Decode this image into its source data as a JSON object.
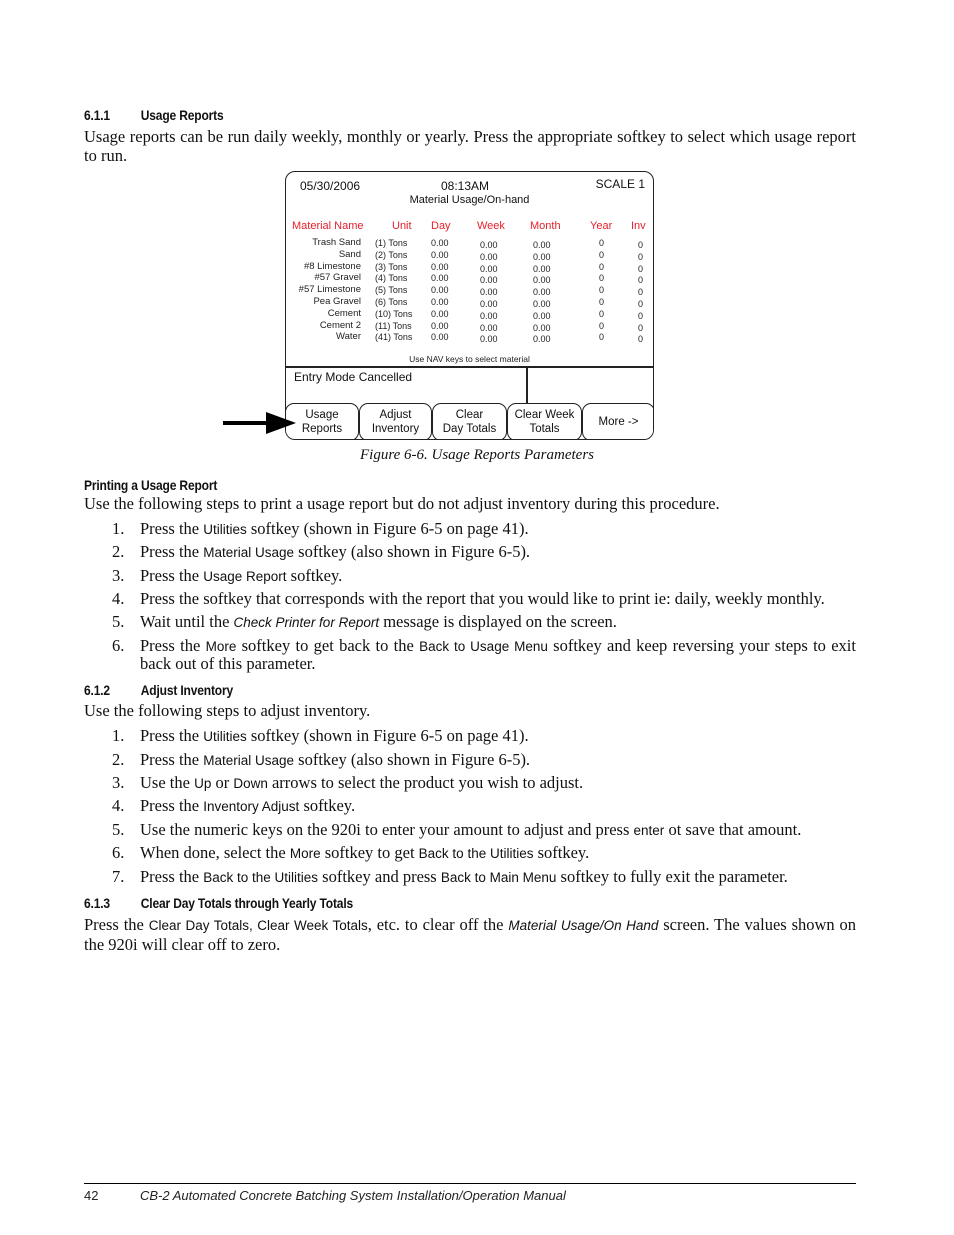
{
  "section_611": {
    "number": "6.1.1",
    "title": "Usage Reports",
    "intro": "Usage reports can be run daily weekly, monthly or yearly. Press the appropriate softkey to select which usage report to run."
  },
  "figure": {
    "date": "05/30/2006",
    "time": "08:13AM",
    "scale": "SCALE 1",
    "screen_title": "Material Usage/On-hand",
    "columns": [
      "Material Name",
      "Unit",
      "Day",
      "Week",
      "Month",
      "Year",
      "Inv"
    ],
    "header_color": "#e8202a",
    "rows": [
      {
        "name": "Trash Sand",
        "unit": "(1) Tons",
        "day": "0.00",
        "week": "0.00",
        "month": "0.00",
        "year": "0",
        "inv": "0"
      },
      {
        "name": "Sand",
        "unit": "(2) Tons",
        "day": "0.00",
        "week": "0.00",
        "month": "0.00",
        "year": "0",
        "inv": "0"
      },
      {
        "name": "#8 Limestone",
        "unit": "(3) Tons",
        "day": "0.00",
        "week": "0.00",
        "month": "0.00",
        "year": "0",
        "inv": "0"
      },
      {
        "name": "#57 Gravel",
        "unit": "(4) Tons",
        "day": "0.00",
        "week": "0.00",
        "month": "0.00",
        "year": "0",
        "inv": "0"
      },
      {
        "name": "#57 Limestone",
        "unit": "(5) Tons",
        "day": "0.00",
        "week": "0.00",
        "month": "0.00",
        "year": "0",
        "inv": "0"
      },
      {
        "name": "Pea Gravel",
        "unit": "(6) Tons",
        "day": "0.00",
        "week": "0.00",
        "month": "0.00",
        "year": "0",
        "inv": "0"
      },
      {
        "name": "Cement",
        "unit": "(10) Tons",
        "day": "0.00",
        "week": "0.00",
        "month": "0.00",
        "year": "0",
        "inv": "0"
      },
      {
        "name": "Cement 2",
        "unit": "(11) Tons",
        "day": "0.00",
        "week": "0.00",
        "month": "0.00",
        "year": "0",
        "inv": "0"
      },
      {
        "name": "Water",
        "unit": "(41) Tons",
        "day": "0.00",
        "week": "0.00",
        "month": "0.00",
        "year": "0",
        "inv": "0"
      }
    ],
    "nav_hint": "Use NAV keys to select material",
    "status_message": "Entry Mode Cancelled",
    "softkeys": [
      {
        "line1": "Usage",
        "line2": "Reports"
      },
      {
        "line1": "Adjust",
        "line2": "Inventory"
      },
      {
        "line1": "Clear",
        "line2": "Day Totals"
      },
      {
        "line1": "Clear Week",
        "line2": "Totals"
      },
      {
        "line1": "More ->",
        "line2": ""
      }
    ],
    "caption": "Figure 6-6. Usage Reports Parameters"
  },
  "printing": {
    "title": "Printing a Usage Report",
    "intro": "Use the following steps to print a usage report but do not adjust inventory during this procedure.",
    "steps": [
      {
        "n": "1.",
        "parts": [
          [
            "t",
            "Press the "
          ],
          [
            "k",
            "Utilities"
          ],
          [
            "t",
            " softkey (shown in Figure 6-5 on page 41)."
          ]
        ]
      },
      {
        "n": "2.",
        "parts": [
          [
            "t",
            "Press the "
          ],
          [
            "k",
            "Material Usage"
          ],
          [
            "t",
            " softkey (also shown in Figure 6-5)."
          ]
        ]
      },
      {
        "n": "3.",
        "parts": [
          [
            "t",
            "Press the "
          ],
          [
            "k",
            "Usage Report"
          ],
          [
            "t",
            " softkey."
          ]
        ]
      },
      {
        "n": "4.",
        "parts": [
          [
            "t",
            "Press the softkey that corresponds with the report that you would like to print ie: daily, weekly monthly."
          ]
        ]
      },
      {
        "n": "5.",
        "parts": [
          [
            "t",
            "Wait until the "
          ],
          [
            "i",
            "Check Printer for Report"
          ],
          [
            "t",
            " message is displayed on the screen."
          ]
        ]
      },
      {
        "n": "6.",
        "parts": [
          [
            "t",
            "Press the "
          ],
          [
            "k",
            "More"
          ],
          [
            "t",
            " softkey to get back to the "
          ],
          [
            "k",
            "Back to Usage Menu"
          ],
          [
            "t",
            " softkey and keep reversing your steps to exit back out of this parameter."
          ]
        ]
      }
    ]
  },
  "section_612": {
    "number": "6.1.2",
    "title": "Adjust Inventory",
    "intro": "Use the following steps to adjust inventory.",
    "steps": [
      {
        "n": "1.",
        "parts": [
          [
            "t",
            "Press the "
          ],
          [
            "k",
            "Utilities"
          ],
          [
            "t",
            " softkey (shown in Figure 6-5 on page 41)."
          ]
        ]
      },
      {
        "n": "2.",
        "parts": [
          [
            "t",
            "Press the "
          ],
          [
            "k",
            "Material Usage"
          ],
          [
            "t",
            " softkey (also shown in Figure 6-5)."
          ]
        ]
      },
      {
        "n": "3.",
        "parts": [
          [
            "t",
            "Use the "
          ],
          [
            "k",
            "Up"
          ],
          [
            "t",
            " or "
          ],
          [
            "k",
            "Down"
          ],
          [
            "t",
            " arrows to select the product you wish to adjust."
          ]
        ]
      },
      {
        "n": "4.",
        "parts": [
          [
            "t",
            "Press the "
          ],
          [
            "k",
            "Inventory Adjust"
          ],
          [
            "t",
            " softkey."
          ]
        ]
      },
      {
        "n": "5.",
        "parts": [
          [
            "t",
            "Use the numeric keys on the 920i to enter your amount to adjust and press "
          ],
          [
            "k",
            "enter"
          ],
          [
            "t",
            " ot save that amount."
          ]
        ]
      },
      {
        "n": "6.",
        "parts": [
          [
            "t",
            "When done, select the "
          ],
          [
            "k",
            "More"
          ],
          [
            "t",
            " softkey to get "
          ],
          [
            "k",
            "Back to the Utilities"
          ],
          [
            "t",
            " softkey."
          ]
        ]
      },
      {
        "n": "7.",
        "parts": [
          [
            "t",
            "Press the "
          ],
          [
            "k",
            "Back to the Utilities"
          ],
          [
            "t",
            " softkey and press "
          ],
          [
            "k",
            "Back to Main Menu"
          ],
          [
            "t",
            " softkey to fully exit the parameter."
          ]
        ]
      }
    ]
  },
  "section_613": {
    "number": "6.1.3",
    "title": "Clear Day Totals through Yearly Totals",
    "parts": [
      [
        "t",
        "Press the "
      ],
      [
        "k",
        "Clear Day Totals, Clear Week Totals"
      ],
      [
        "t",
        ", etc. to clear off the "
      ],
      [
        "i",
        "Material Usage/On Hand"
      ],
      [
        "t",
        " screen. The values shown on the 920i will clear off to zero."
      ]
    ]
  },
  "footer": {
    "page_number": "42",
    "manual_title": "CB-2 Automated Concrete Batching System Installation/Operation Manual"
  }
}
